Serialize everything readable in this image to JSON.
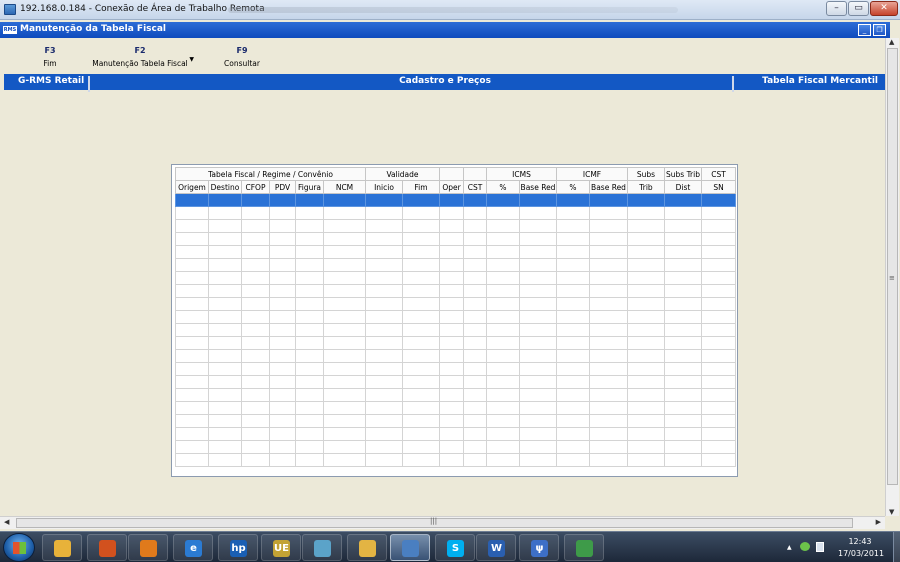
{
  "remote_window": {
    "title": "192.168.0.184 - Conexão de Área de Trabalho Remota",
    "min_label": "–",
    "max_label": "▭",
    "close_label": "✕"
  },
  "app_window": {
    "title": "Manutenção da Tabela Fiscal",
    "logo_text": "RMS",
    "min_label": "_",
    "restore_label": "❐"
  },
  "toolbar": {
    "f3_key": "F3",
    "f3_label": "Fim",
    "f2_key": "F2",
    "f2_label": "Manutenção Tabela Fiscal",
    "f9_key": "F9",
    "f9_label": "Consultar"
  },
  "section_bar": {
    "left": "G-RMS Retail",
    "center": "Cadastro e Preços",
    "right": "Tabela Fiscal Mercantil"
  },
  "grid": {
    "group_headers": [
      {
        "label": "Tabela Fiscal / Regime / Convênio",
        "span": 6
      },
      {
        "label": "Validade",
        "span": 2
      },
      {
        "label": "",
        "span": 1
      },
      {
        "label": "",
        "span": 1
      },
      {
        "label": "ICMS",
        "span": 2
      },
      {
        "label": "ICMF",
        "span": 2
      },
      {
        "label": "Subs",
        "span": 1
      },
      {
        "label": "Subs Trib",
        "span": 1
      },
      {
        "label": "CST",
        "span": 1
      }
    ],
    "columns": [
      "Origem",
      "Destino",
      "CFOP",
      "PDV",
      "Figura",
      "NCM",
      "Inicio",
      "Fim",
      "Oper",
      "CST",
      "%",
      "Base Red",
      "%",
      "Base Red",
      "Trib",
      "Dist",
      "SN"
    ]
  },
  "taskbar": {
    "clock_time": "12:43",
    "clock_date": "17/03/2011",
    "apps": [
      {
        "name": "explorer-icon",
        "color": "#e8b23a"
      },
      {
        "name": "firefox-icon",
        "color": "#d2511e"
      },
      {
        "name": "media-player-icon",
        "color": "#e07a1c"
      },
      {
        "name": "internet-explorer-icon",
        "color": "#2b7bd3",
        "glyph": "e"
      },
      {
        "name": "hp-icon",
        "color": "#1a5fb4",
        "glyph": "hp"
      },
      {
        "name": "ue-icon",
        "color": "#c2a234",
        "glyph": "UE"
      },
      {
        "name": "contacts-icon",
        "color": "#5ba3c9"
      },
      {
        "name": "mail-icon",
        "color": "#e3b443"
      },
      {
        "name": "remote-desktop-icon",
        "color": "#4a7fc1"
      },
      {
        "name": "skype-icon",
        "color": "#00aff0",
        "glyph": "S"
      },
      {
        "name": "word-icon",
        "color": "#2a5fb0",
        "glyph": "W"
      },
      {
        "name": "psi-icon",
        "color": "#3d6fc7",
        "glyph": "ψ"
      },
      {
        "name": "cashier-icon",
        "color": "#3e9b49"
      }
    ]
  }
}
